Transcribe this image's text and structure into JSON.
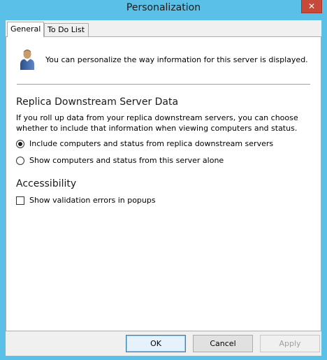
{
  "window": {
    "title": "Personalization",
    "close_glyph": "✕"
  },
  "tabs": [
    {
      "label": "General",
      "active": true
    },
    {
      "label": "To Do List",
      "active": false
    }
  ],
  "general": {
    "intro_text": "You can personalize the way information for this server is displayed.",
    "replica_heading": "Replica Downstream Server Data",
    "replica_description": "If you roll up data from your replica downstream servers, you can choose whether to include that information when viewing computers and status.",
    "options": [
      {
        "label": "Include computers and status from replica downstream servers",
        "checked": true
      },
      {
        "label": "Show computers and status from this server alone",
        "checked": false
      }
    ],
    "accessibility_heading": "Accessibility",
    "validation_checkbox": {
      "label": "Show validation errors in popups",
      "checked": false
    }
  },
  "buttons": {
    "ok": "OK",
    "cancel": "Cancel",
    "apply": "Apply"
  },
  "colors": {
    "frame": "#5bc0e8",
    "close": "#c7493a"
  }
}
